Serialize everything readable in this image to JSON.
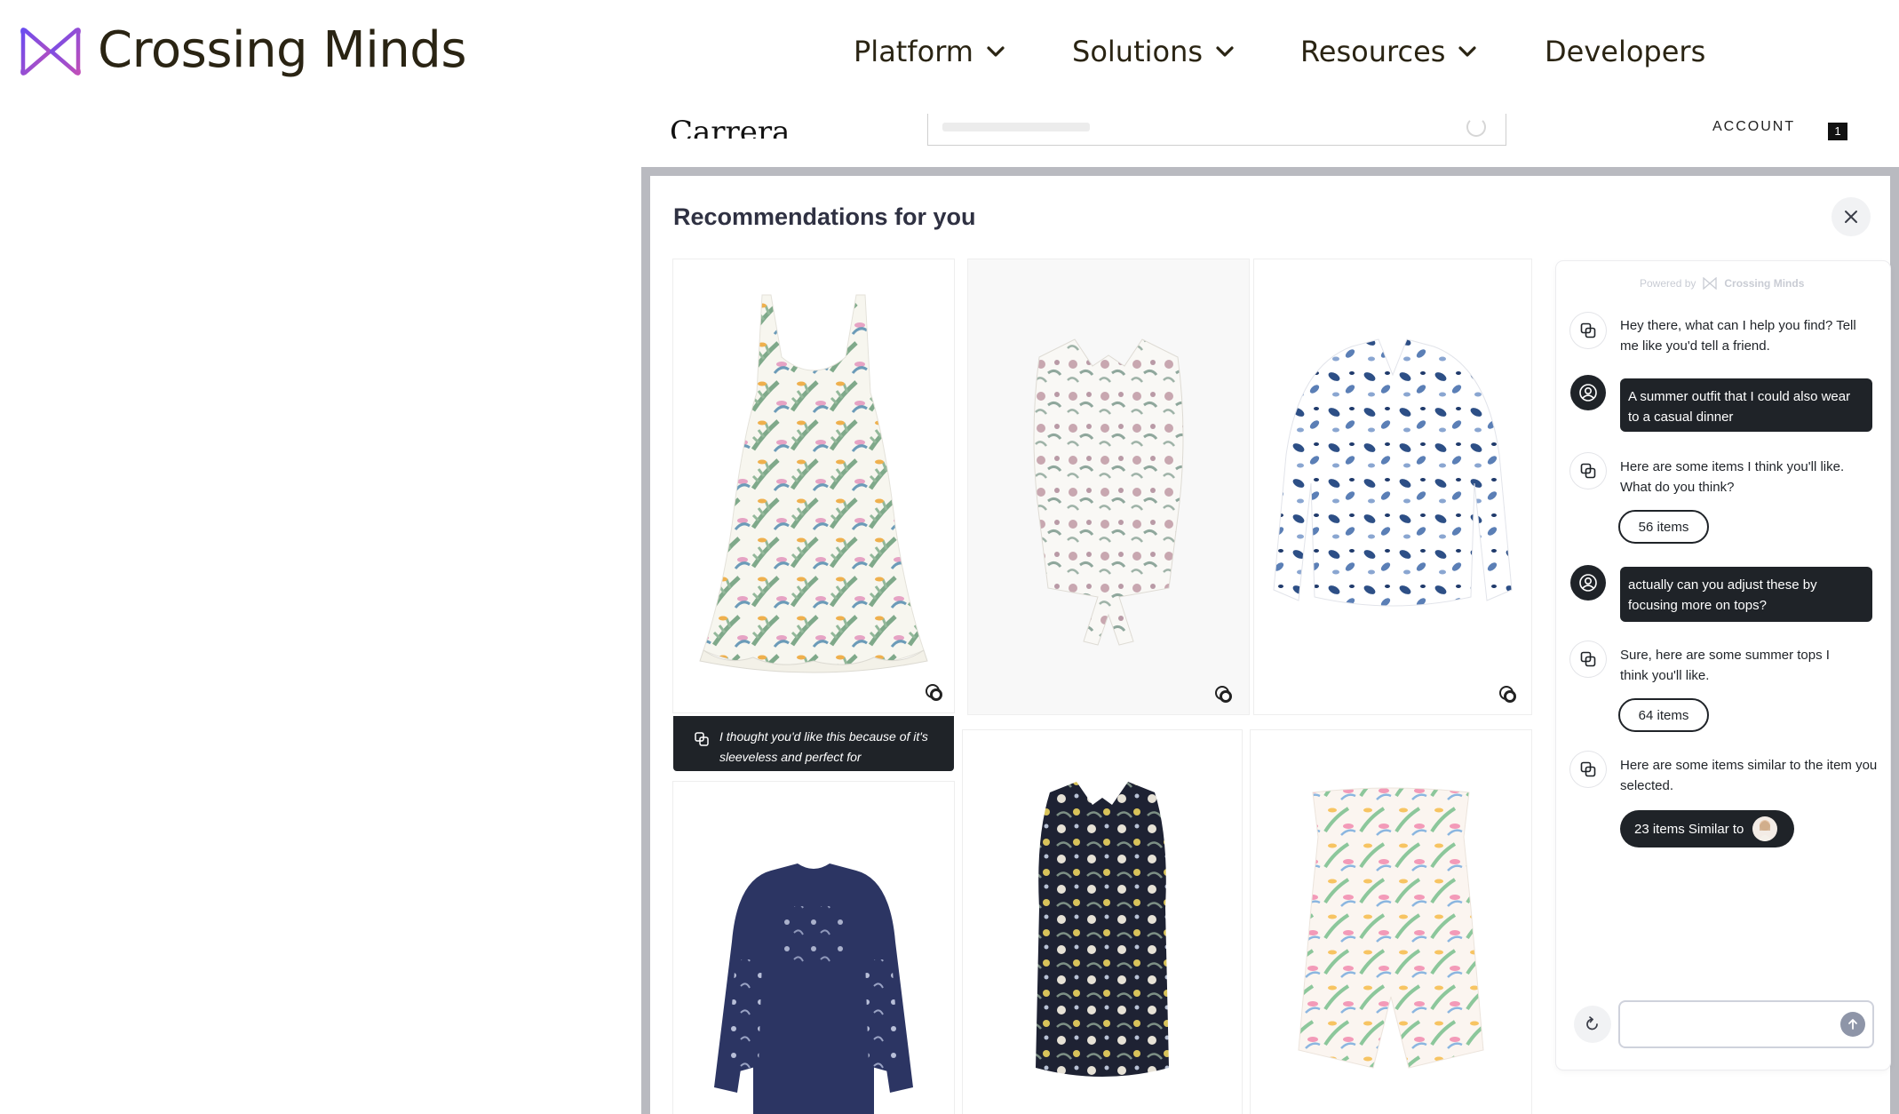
{
  "brand": {
    "name": "Crossing Minds",
    "accent": "#6a4cf0",
    "accent_secondary": "#b04fcf"
  },
  "nav": {
    "items": [
      {
        "label": "Platform",
        "has_dropdown": true
      },
      {
        "label": "Solutions",
        "has_dropdown": true
      },
      {
        "label": "Resources",
        "has_dropdown": true
      },
      {
        "label": "Developers",
        "has_dropdown": false
      }
    ]
  },
  "store": {
    "name": "Carrera",
    "account_label": "ACCOUNT",
    "cart_count": "1"
  },
  "modal": {
    "title": "Recommendations for you",
    "reason_text": "I thought you'd like this because of it's sleeveless and perfect for",
    "products": [
      {
        "name": "floral-palm-dress"
      },
      {
        "name": "floral-sleeveless-tie-top"
      },
      {
        "name": "blue-watercolor-blouse"
      },
      {
        "name": "navy-embroidered-dress"
      },
      {
        "name": "dark-floral-sleeveless-shirt"
      },
      {
        "name": "tropical-strapless-romper"
      }
    ]
  },
  "chat": {
    "powered_by": "Powered by",
    "powered_brand": "Crossing Minds",
    "messages": [
      {
        "from": "bot",
        "text": "Hey there, what can I help you find? Tell me like you'd tell a friend."
      },
      {
        "from": "user",
        "text": "A summer outfit that I could also wear to a casual dinner"
      },
      {
        "from": "bot",
        "text": "Here are some items I think you'll like. What do you think?",
        "pill": "56 items"
      },
      {
        "from": "user",
        "text": "actually can you adjust these by focusing more on tops?"
      },
      {
        "from": "bot",
        "text": "Sure, here are some summer tops I think you'll like.",
        "pill": "64 items"
      },
      {
        "from": "bot",
        "text": "Here are some items similar to the item you selected.",
        "pill": "23 items Similar to"
      }
    ],
    "input_placeholder": ""
  }
}
